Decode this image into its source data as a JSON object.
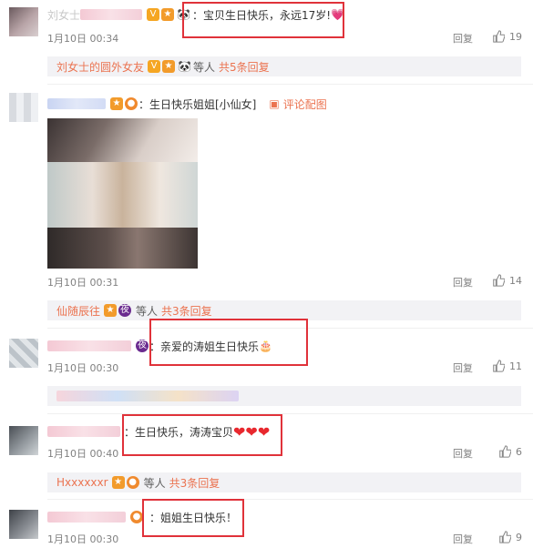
{
  "comments": [
    {
      "name_visible": "刘女士",
      "text": "：宝贝生日快乐，永远17岁!",
      "emoji": "💗",
      "date": "1月10日 00:34",
      "reply": "回复",
      "likes": "19"
    },
    {
      "text": "：生日快乐姐姐[小仙女]",
      "image_link": "评论配图",
      "date": "1月10日 00:31",
      "reply": "回复",
      "likes": "14"
    },
    {
      "text": "：亲爱的涛姐生日快乐",
      "emoji": "🎂",
      "date": "1月10日 00:30",
      "reply": "回复",
      "likes": "11"
    },
    {
      "text": "：生日快乐，涛涛宝贝",
      "emoji": "❤❤❤",
      "date": "1月10日 00:40",
      "reply": "回复",
      "likes": "6"
    },
    {
      "text": "：姐姐生日快乐！",
      "date": "1月10日 00:30",
      "reply": "回复",
      "likes": "9"
    }
  ],
  "subreplies": [
    {
      "name": "刘女士的圆外女友",
      "suffix": "等人",
      "count": "共5条回复"
    },
    {
      "name": "仙随辰往",
      "suffix": "等人",
      "count": "共3条回复"
    },
    {
      "name": "Hxxxxxxr",
      "suffix": "等人",
      "count": "共3条回复"
    }
  ],
  "icons": {
    "like": "thumbs-up-icon",
    "image": "picture-icon"
  },
  "colors": {
    "link": "#eb7350",
    "highlight_box": "#e0323a"
  }
}
